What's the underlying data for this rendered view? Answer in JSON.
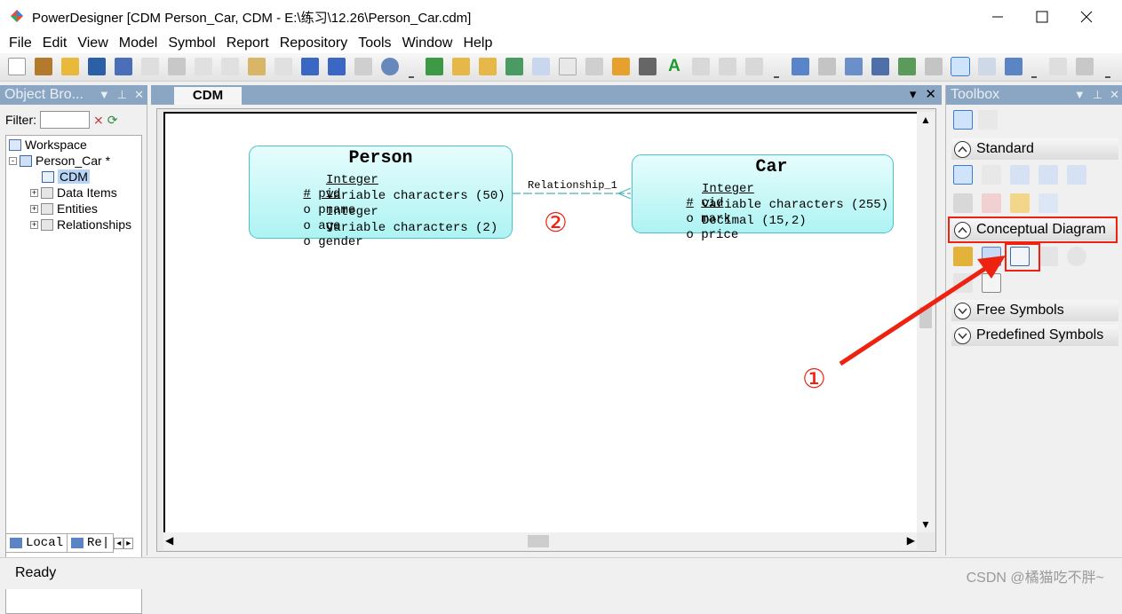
{
  "window": {
    "title": "PowerDesigner [CDM Person_Car, CDM - E:\\练习\\12.26\\Person_Car.cdm]",
    "controls": [
      "minimize",
      "maximize",
      "close"
    ]
  },
  "menu": [
    "File",
    "Edit",
    "View",
    "Model",
    "Symbol",
    "Report",
    "Repository",
    "Tools",
    "Window",
    "Help"
  ],
  "object_browser": {
    "title": "Object Bro...",
    "filter_label": "Filter:",
    "filter_value": "",
    "tree": [
      {
        "label": "Workspace",
        "level": 0,
        "icon": "workspace-icon"
      },
      {
        "label": "Person_Car *",
        "level": 1,
        "icon": "model-icon",
        "expander": "-"
      },
      {
        "label": "CDM",
        "level": 2,
        "icon": "diagram-icon",
        "selected": true
      },
      {
        "label": "Data Items",
        "level": 2,
        "icon": "folder-icon",
        "expander": "+"
      },
      {
        "label": "Entities",
        "level": 2,
        "icon": "folder-icon",
        "expander": "+"
      },
      {
        "label": "Relationships",
        "level": 2,
        "icon": "folder-icon",
        "expander": "+"
      }
    ],
    "tabs": [
      "Local",
      "Re|"
    ]
  },
  "diagram": {
    "tab": "CDM",
    "entities": [
      {
        "name": "Person",
        "attributes": [
          {
            "marker": "#",
            "name": "pid",
            "type": "Integer",
            "identifier": true
          },
          {
            "marker": "o",
            "name": "pname",
            "type": "Variable characters (50)",
            "identifier": false
          },
          {
            "marker": "o",
            "name": "age",
            "type": "Integer",
            "identifier": false
          },
          {
            "marker": "o",
            "name": "gender",
            "type": "Variable characters (2)",
            "identifier": false
          }
        ]
      },
      {
        "name": "Car",
        "attributes": [
          {
            "marker": "#",
            "name": "cid",
            "type": "Integer",
            "identifier": true
          },
          {
            "marker": "o",
            "name": "mark",
            "type": "Variable characters (255)",
            "identifier": false
          },
          {
            "marker": "o",
            "name": "price",
            "type": "Decimal (15,2)",
            "identifier": false
          }
        ]
      }
    ],
    "relationship": {
      "label": "Relationship_1",
      "from": "Person",
      "to": "Car"
    }
  },
  "toolbox": {
    "title": "Toolbox",
    "sections": [
      {
        "label": "Standard",
        "expanded": true
      },
      {
        "label": "Conceptual Diagram",
        "expanded": true,
        "highlighted": true
      },
      {
        "label": "Free Symbols",
        "expanded": false
      },
      {
        "label": "Predefined Symbols",
        "expanded": false
      }
    ]
  },
  "annotations": {
    "marker_1": "①",
    "marker_2": "②",
    "color": "#ee2211"
  },
  "statusbar": {
    "text": "Ready",
    "watermark": "CSDN @橘猫吃不胖~"
  }
}
